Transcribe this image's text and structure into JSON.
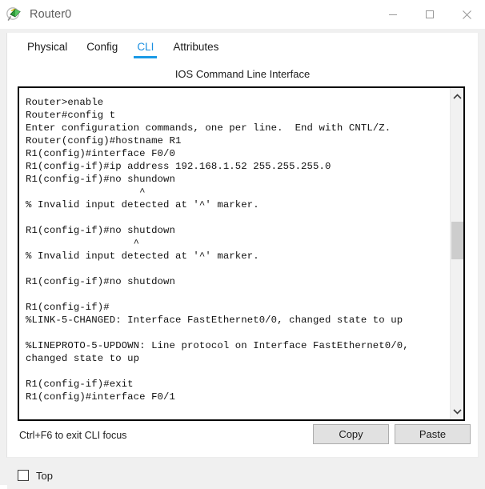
{
  "window": {
    "title": "Router0",
    "icon": "router-device-icon",
    "controls": {
      "minimize": "minimize-icon",
      "maximize": "maximize-icon",
      "close": "close-icon"
    }
  },
  "tabs": [
    {
      "label": "Physical",
      "active": false
    },
    {
      "label": "Config",
      "active": false
    },
    {
      "label": "CLI",
      "active": true
    },
    {
      "label": "Attributes",
      "active": false
    }
  ],
  "cli": {
    "header": "IOS Command Line Interface",
    "terminal_text": "Router>enable\nRouter#config t\nEnter configuration commands, one per line.  End with CNTL/Z.\nRouter(config)#hostname R1\nR1(config)#interface F0/0\nR1(config-if)#ip address 192.168.1.52 255.255.255.0\nR1(config-if)#no shundown\n                   ^\n% Invalid input detected at '^' marker.\n\nR1(config-if)#no shutdown\n                  ^\n% Invalid input detected at '^' marker.\n\nR1(config-if)#no shutdown\n\nR1(config-if)#\n%LINK-5-CHANGED: Interface FastEthernet0/0, changed state to up\n\n%LINEPROTO-5-UPDOWN: Line protocol on Interface FastEthernet0/0,\nchanged state to up\n\nR1(config-if)#exit\nR1(config)#interface F0/1",
    "scroll_up": "chevron-up-icon",
    "scroll_down": "chevron-down-icon"
  },
  "footer": {
    "hint": "Ctrl+F6 to exit CLI focus",
    "copy_label": "Copy",
    "paste_label": "Paste"
  },
  "bottom": {
    "top_label": "Top",
    "top_checked": false
  },
  "colors": {
    "accent": "#1a9ae6",
    "window_bg": "#f0f0f0",
    "panel_bg": "#ffffff",
    "terminal_fg": "#111111",
    "button_face": "#e1e1e1"
  }
}
